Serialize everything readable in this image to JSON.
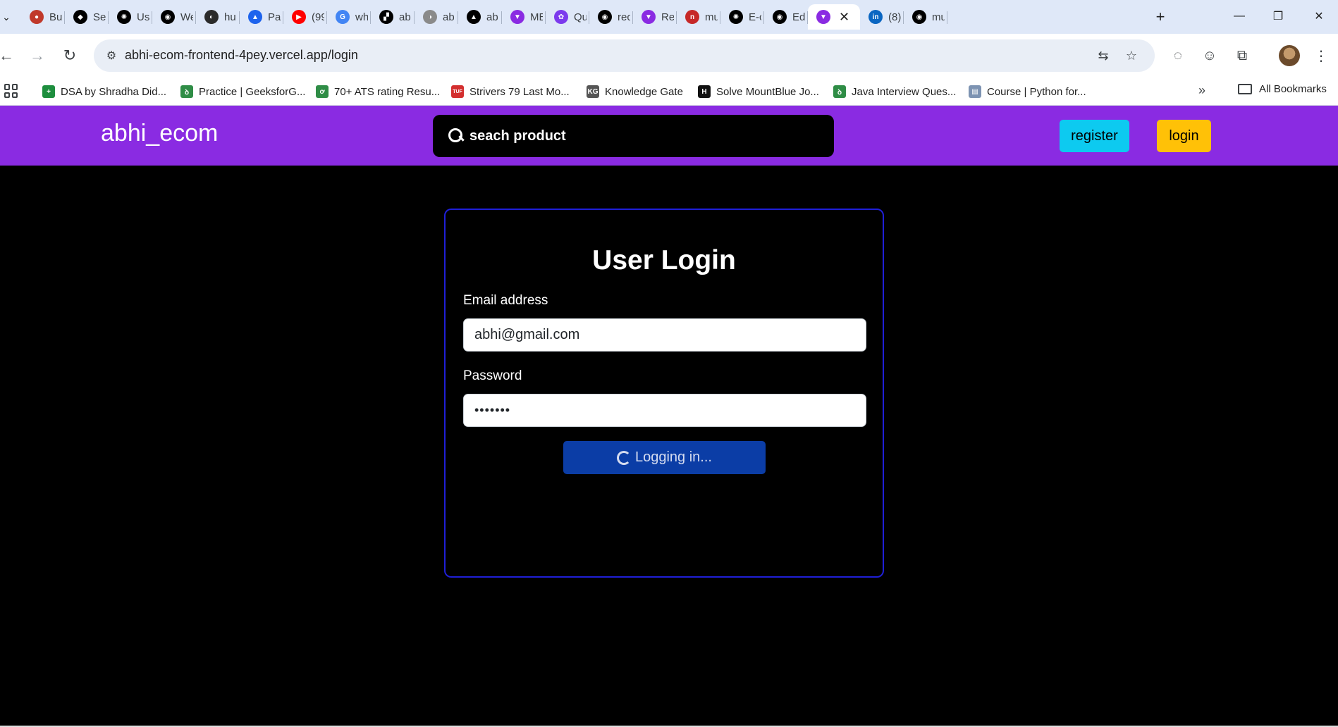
{
  "browser": {
    "tabs": [
      {
        "title": "Bu",
        "fav_color": "#c0392b",
        "fav_glyph": "●"
      },
      {
        "title": "Se",
        "fav_color": "#000000",
        "fav_glyph": "◆"
      },
      {
        "title": "Us",
        "fav_color": "#000000",
        "fav_glyph": "✺"
      },
      {
        "title": "We",
        "fav_color": "#000000",
        "fav_glyph": "◉"
      },
      {
        "title": "hu",
        "fav_color": "#2b2b2b",
        "fav_glyph": "◐"
      },
      {
        "title": "Pa",
        "fav_color": "#1d63ed",
        "fav_glyph": "▲"
      },
      {
        "title": "(99",
        "fav_color": "#ff0000",
        "fav_glyph": "▶"
      },
      {
        "title": "wh",
        "fav_color": "#4285f4",
        "fav_glyph": "G"
      },
      {
        "title": "ab",
        "fav_color": "#000000",
        "fav_glyph": "▞"
      },
      {
        "title": "ab",
        "fav_color": "#8a8a8a",
        "fav_glyph": "◑"
      },
      {
        "title": "ab",
        "fav_color": "#000000",
        "fav_glyph": "▲"
      },
      {
        "title": "ME",
        "fav_color": "#8a2be2",
        "fav_glyph": "▼"
      },
      {
        "title": "Qu",
        "fav_color": "#7c3aed",
        "fav_glyph": "✿"
      },
      {
        "title": "rec",
        "fav_color": "#000000",
        "fav_glyph": "◉"
      },
      {
        "title": "Re",
        "fav_color": "#8a2be2",
        "fav_glyph": "▼"
      },
      {
        "title": "mu",
        "fav_color": "#c62828",
        "fav_glyph": "n"
      },
      {
        "title": "E-c",
        "fav_color": "#000000",
        "fav_glyph": "✺"
      },
      {
        "title": "Ed",
        "fav_color": "#000000",
        "fav_glyph": "◉"
      },
      {
        "title": "",
        "fav_color": "#8a2be2",
        "fav_glyph": "▼",
        "active": true
      },
      {
        "title": "(8)",
        "fav_color": "#0a66c2",
        "fav_glyph": "in"
      },
      {
        "title": "mu",
        "fav_color": "#000000",
        "fav_glyph": "◉"
      }
    ],
    "active_close": "✕",
    "new_tab": "+",
    "window_controls": {
      "minimize": "—",
      "restore": "❐",
      "close": "✕"
    },
    "url": "abhi-ecom-frontend-4pey.vercel.app/login",
    "bookmarks": [
      {
        "label": "DSA by Shradha Did...",
        "fav_color": "#1e8e3e",
        "fav_glyph": "+"
      },
      {
        "label": "Practice | GeeksforG...",
        "fav_color": "#2f8d46",
        "fav_glyph": "ꝺ"
      },
      {
        "label": "70+ ATS rating Resu...",
        "fav_color": "#2f8d46",
        "fav_glyph": "ơ"
      },
      {
        "label": "Strivers 79 Last Mo...",
        "fav_color": "#d32f2f",
        "fav_glyph": "TUF"
      },
      {
        "label": "Knowledge Gate",
        "fav_color": "#555555",
        "fav_glyph": "KG"
      },
      {
        "label": "Solve MountBlue Jo...",
        "fav_color": "#111111",
        "fav_glyph": "H"
      },
      {
        "label": "Java Interview Ques...",
        "fav_color": "#2f8d46",
        "fav_glyph": "ꝺ"
      },
      {
        "label": "Course | Python for...",
        "fav_color": "#7d93b2",
        "fav_glyph": "▤"
      }
    ],
    "all_bookmarks": "All Bookmarks",
    "more": "»"
  },
  "site": {
    "brand": "abhi_ecom",
    "search_placeholder": "seach product",
    "register": "register",
    "login": "login"
  },
  "login_form": {
    "title": "User Login",
    "email_label": "Email address",
    "email_value": "abhi@gmail.com",
    "password_label": "Password",
    "password_mask": "•••••••",
    "submit_label": "Logging in..."
  },
  "colors": {
    "navbar": "#8a2be2",
    "register_button": "#0dcaf0",
    "login_button": "#ffc107",
    "card_border": "#1f1fd6",
    "submit_button": "#0b3da6"
  }
}
